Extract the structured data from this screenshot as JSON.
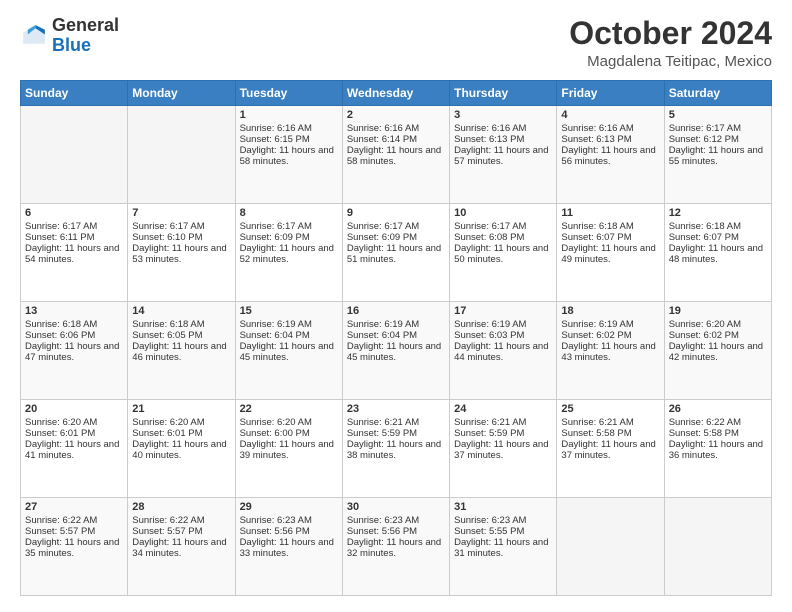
{
  "logo": {
    "general": "General",
    "blue": "Blue"
  },
  "header": {
    "month": "October 2024",
    "location": "Magdalena Teitipac, Mexico"
  },
  "days_of_week": [
    "Sunday",
    "Monday",
    "Tuesday",
    "Wednesday",
    "Thursday",
    "Friday",
    "Saturday"
  ],
  "weeks": [
    [
      {
        "day": "",
        "sunrise": "",
        "sunset": "",
        "daylight": ""
      },
      {
        "day": "",
        "sunrise": "",
        "sunset": "",
        "daylight": ""
      },
      {
        "day": "1",
        "sunrise": "Sunrise: 6:16 AM",
        "sunset": "Sunset: 6:15 PM",
        "daylight": "Daylight: 11 hours and 58 minutes."
      },
      {
        "day": "2",
        "sunrise": "Sunrise: 6:16 AM",
        "sunset": "Sunset: 6:14 PM",
        "daylight": "Daylight: 11 hours and 58 minutes."
      },
      {
        "day": "3",
        "sunrise": "Sunrise: 6:16 AM",
        "sunset": "Sunset: 6:13 PM",
        "daylight": "Daylight: 11 hours and 57 minutes."
      },
      {
        "day": "4",
        "sunrise": "Sunrise: 6:16 AM",
        "sunset": "Sunset: 6:13 PM",
        "daylight": "Daylight: 11 hours and 56 minutes."
      },
      {
        "day": "5",
        "sunrise": "Sunrise: 6:17 AM",
        "sunset": "Sunset: 6:12 PM",
        "daylight": "Daylight: 11 hours and 55 minutes."
      }
    ],
    [
      {
        "day": "6",
        "sunrise": "Sunrise: 6:17 AM",
        "sunset": "Sunset: 6:11 PM",
        "daylight": "Daylight: 11 hours and 54 minutes."
      },
      {
        "day": "7",
        "sunrise": "Sunrise: 6:17 AM",
        "sunset": "Sunset: 6:10 PM",
        "daylight": "Daylight: 11 hours and 53 minutes."
      },
      {
        "day": "8",
        "sunrise": "Sunrise: 6:17 AM",
        "sunset": "Sunset: 6:09 PM",
        "daylight": "Daylight: 11 hours and 52 minutes."
      },
      {
        "day": "9",
        "sunrise": "Sunrise: 6:17 AM",
        "sunset": "Sunset: 6:09 PM",
        "daylight": "Daylight: 11 hours and 51 minutes."
      },
      {
        "day": "10",
        "sunrise": "Sunrise: 6:17 AM",
        "sunset": "Sunset: 6:08 PM",
        "daylight": "Daylight: 11 hours and 50 minutes."
      },
      {
        "day": "11",
        "sunrise": "Sunrise: 6:18 AM",
        "sunset": "Sunset: 6:07 PM",
        "daylight": "Daylight: 11 hours and 49 minutes."
      },
      {
        "day": "12",
        "sunrise": "Sunrise: 6:18 AM",
        "sunset": "Sunset: 6:07 PM",
        "daylight": "Daylight: 11 hours and 48 minutes."
      }
    ],
    [
      {
        "day": "13",
        "sunrise": "Sunrise: 6:18 AM",
        "sunset": "Sunset: 6:06 PM",
        "daylight": "Daylight: 11 hours and 47 minutes."
      },
      {
        "day": "14",
        "sunrise": "Sunrise: 6:18 AM",
        "sunset": "Sunset: 6:05 PM",
        "daylight": "Daylight: 11 hours and 46 minutes."
      },
      {
        "day": "15",
        "sunrise": "Sunrise: 6:19 AM",
        "sunset": "Sunset: 6:04 PM",
        "daylight": "Daylight: 11 hours and 45 minutes."
      },
      {
        "day": "16",
        "sunrise": "Sunrise: 6:19 AM",
        "sunset": "Sunset: 6:04 PM",
        "daylight": "Daylight: 11 hours and 45 minutes."
      },
      {
        "day": "17",
        "sunrise": "Sunrise: 6:19 AM",
        "sunset": "Sunset: 6:03 PM",
        "daylight": "Daylight: 11 hours and 44 minutes."
      },
      {
        "day": "18",
        "sunrise": "Sunrise: 6:19 AM",
        "sunset": "Sunset: 6:02 PM",
        "daylight": "Daylight: 11 hours and 43 minutes."
      },
      {
        "day": "19",
        "sunrise": "Sunrise: 6:20 AM",
        "sunset": "Sunset: 6:02 PM",
        "daylight": "Daylight: 11 hours and 42 minutes."
      }
    ],
    [
      {
        "day": "20",
        "sunrise": "Sunrise: 6:20 AM",
        "sunset": "Sunset: 6:01 PM",
        "daylight": "Daylight: 11 hours and 41 minutes."
      },
      {
        "day": "21",
        "sunrise": "Sunrise: 6:20 AM",
        "sunset": "Sunset: 6:01 PM",
        "daylight": "Daylight: 11 hours and 40 minutes."
      },
      {
        "day": "22",
        "sunrise": "Sunrise: 6:20 AM",
        "sunset": "Sunset: 6:00 PM",
        "daylight": "Daylight: 11 hours and 39 minutes."
      },
      {
        "day": "23",
        "sunrise": "Sunrise: 6:21 AM",
        "sunset": "Sunset: 5:59 PM",
        "daylight": "Daylight: 11 hours and 38 minutes."
      },
      {
        "day": "24",
        "sunrise": "Sunrise: 6:21 AM",
        "sunset": "Sunset: 5:59 PM",
        "daylight": "Daylight: 11 hours and 37 minutes."
      },
      {
        "day": "25",
        "sunrise": "Sunrise: 6:21 AM",
        "sunset": "Sunset: 5:58 PM",
        "daylight": "Daylight: 11 hours and 37 minutes."
      },
      {
        "day": "26",
        "sunrise": "Sunrise: 6:22 AM",
        "sunset": "Sunset: 5:58 PM",
        "daylight": "Daylight: 11 hours and 36 minutes."
      }
    ],
    [
      {
        "day": "27",
        "sunrise": "Sunrise: 6:22 AM",
        "sunset": "Sunset: 5:57 PM",
        "daylight": "Daylight: 11 hours and 35 minutes."
      },
      {
        "day": "28",
        "sunrise": "Sunrise: 6:22 AM",
        "sunset": "Sunset: 5:57 PM",
        "daylight": "Daylight: 11 hours and 34 minutes."
      },
      {
        "day": "29",
        "sunrise": "Sunrise: 6:23 AM",
        "sunset": "Sunset: 5:56 PM",
        "daylight": "Daylight: 11 hours and 33 minutes."
      },
      {
        "day": "30",
        "sunrise": "Sunrise: 6:23 AM",
        "sunset": "Sunset: 5:56 PM",
        "daylight": "Daylight: 11 hours and 32 minutes."
      },
      {
        "day": "31",
        "sunrise": "Sunrise: 6:23 AM",
        "sunset": "Sunset: 5:55 PM",
        "daylight": "Daylight: 11 hours and 31 minutes."
      },
      {
        "day": "",
        "sunrise": "",
        "sunset": "",
        "daylight": ""
      },
      {
        "day": "",
        "sunrise": "",
        "sunset": "",
        "daylight": ""
      }
    ]
  ]
}
